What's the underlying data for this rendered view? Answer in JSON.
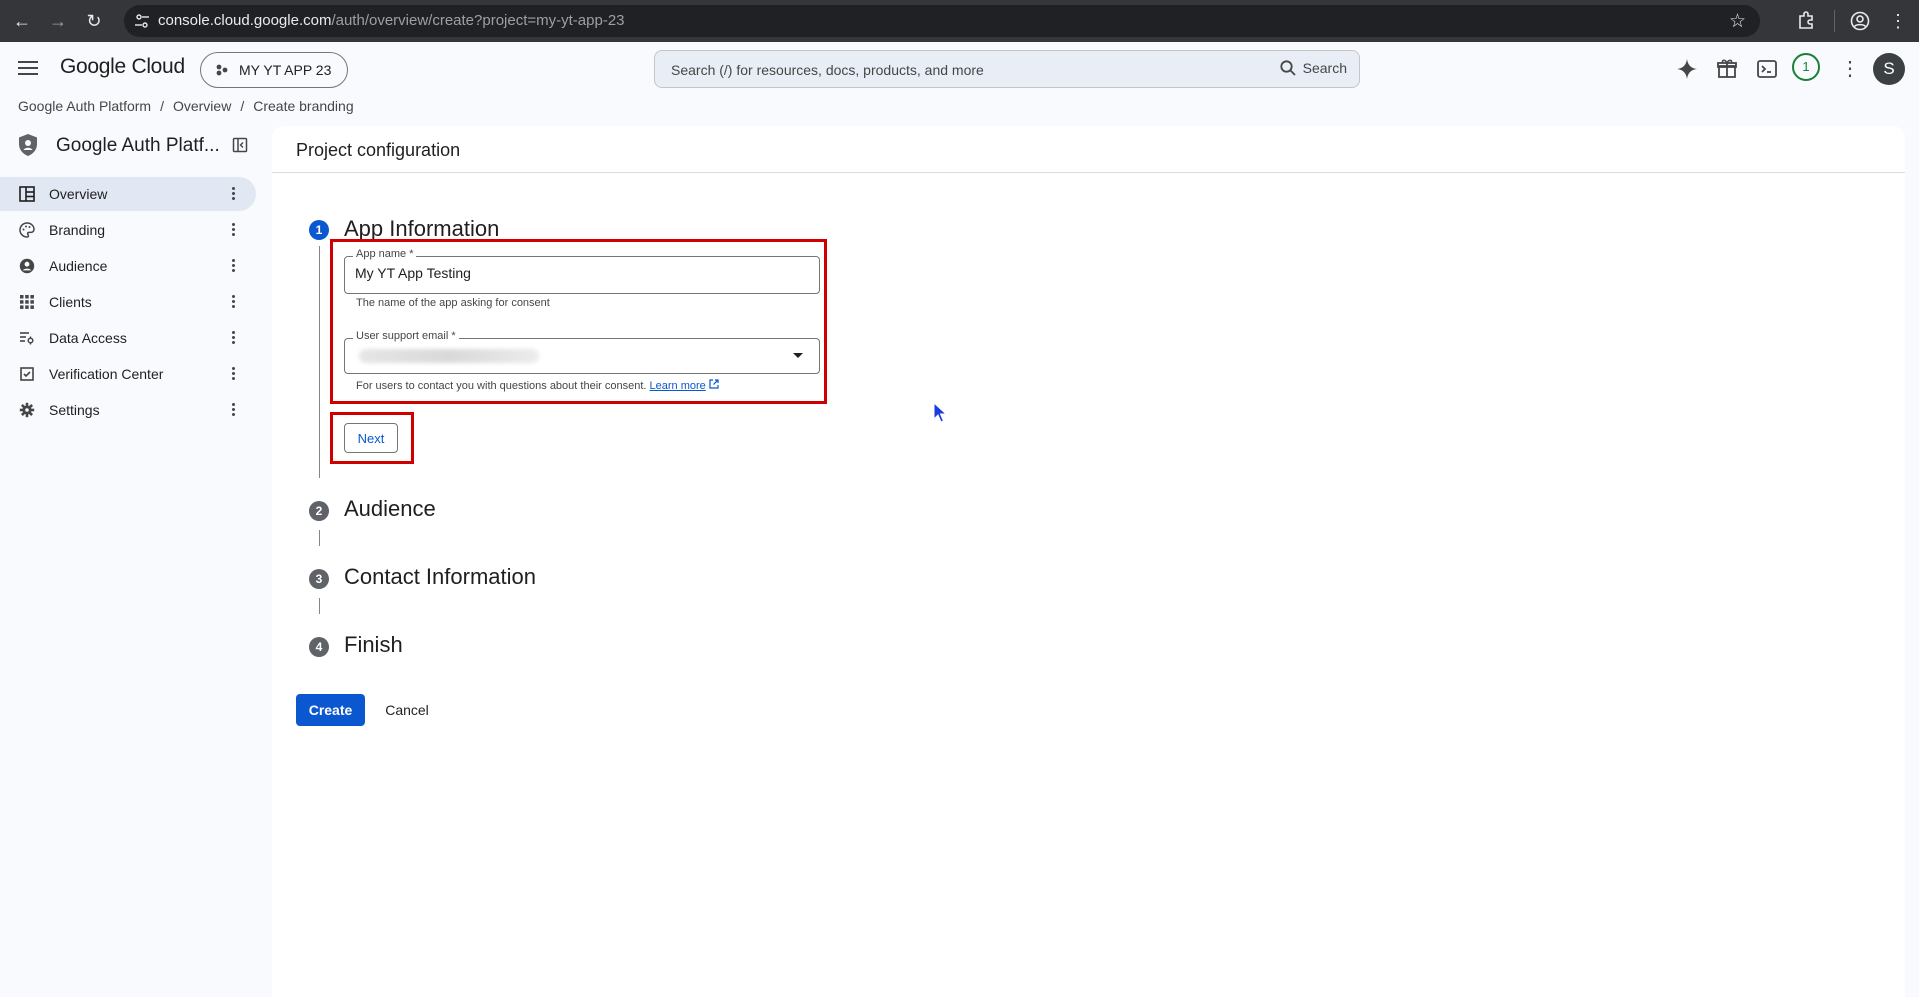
{
  "browser": {
    "url_host": "console.cloud.google.com",
    "url_path": "/auth/overview/create?project=my-yt-app-23"
  },
  "header": {
    "logo": "Google Cloud",
    "project": "MY YT APP 23",
    "search_placeholder": "Search (/) for resources, docs, products, and more",
    "search_button": "Search",
    "notification_count": "1",
    "avatar_initial": "S"
  },
  "breadcrumb": [
    "Google Auth Platform",
    "Overview",
    "Create branding"
  ],
  "sidebar": {
    "title": "Google Auth Platf...",
    "items": [
      {
        "label": "Overview",
        "icon": "dashboard-icon",
        "active": true
      },
      {
        "label": "Branding",
        "icon": "palette-icon"
      },
      {
        "label": "Audience",
        "icon": "person-circle-icon"
      },
      {
        "label": "Clients",
        "icon": "grid-dots-icon"
      },
      {
        "label": "Data Access",
        "icon": "data-access-icon"
      },
      {
        "label": "Verification Center",
        "icon": "checkbox-icon"
      },
      {
        "label": "Settings",
        "icon": "gear-icon"
      }
    ]
  },
  "main": {
    "title": "Project configuration",
    "steps": [
      {
        "number": "1",
        "title": "App Information"
      },
      {
        "number": "2",
        "title": "Audience"
      },
      {
        "number": "3",
        "title": "Contact Information"
      },
      {
        "number": "4",
        "title": "Finish"
      }
    ],
    "app_name": {
      "label": "App name *",
      "value": "My YT App Testing",
      "hint": "The name of the app asking for consent"
    },
    "support_email": {
      "label": "User support email *",
      "hint": "For users to contact you with questions about their consent.",
      "learn_more": "Learn more"
    },
    "next_label": "Next",
    "create_label": "Create",
    "cancel_label": "Cancel"
  },
  "colors": {
    "accent": "#0b57d0",
    "highlight_box": "#d00000",
    "step_active": "#0b57d0",
    "step_inactive": "#5f6368"
  }
}
